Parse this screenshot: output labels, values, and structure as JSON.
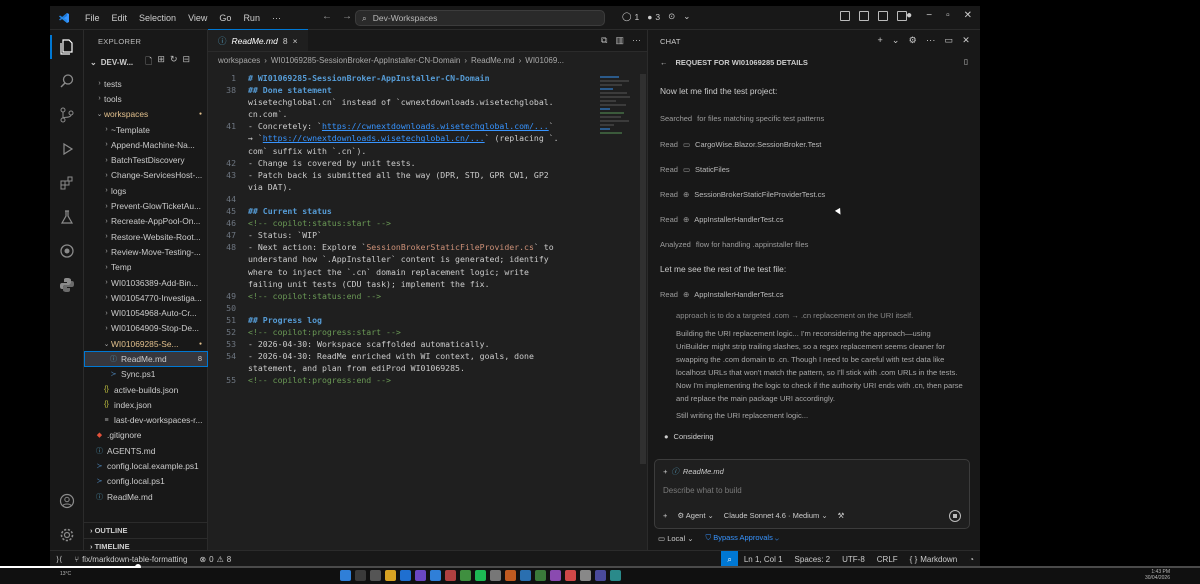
{
  "titlebar": {
    "menu": [
      "File",
      "Edit",
      "Selection",
      "View",
      "Go",
      "Run",
      "···"
    ],
    "search_text": "Dev-Workspaces",
    "counter1": "1",
    "counter2": "3"
  },
  "sidebar": {
    "header": "EXPLORER",
    "root": "DEV-W...",
    "items": [
      {
        "label": "tests",
        "type": "folder",
        "depth": 1,
        "open": false
      },
      {
        "label": "tools",
        "type": "folder",
        "depth": 1,
        "open": false
      },
      {
        "label": "workspaces",
        "type": "folder",
        "depth": 1,
        "open": true,
        "dot": true
      },
      {
        "label": "~Template",
        "type": "folder",
        "depth": 2,
        "open": false
      },
      {
        "label": "Append-Machine-Na...",
        "type": "folder",
        "depth": 2,
        "open": false
      },
      {
        "label": "BatchTestDiscovery",
        "type": "folder",
        "depth": 2,
        "open": false
      },
      {
        "label": "Change-ServicesHost-...",
        "type": "folder",
        "depth": 2,
        "open": false
      },
      {
        "label": "logs",
        "type": "folder",
        "depth": 2,
        "open": false
      },
      {
        "label": "Prevent-GlowTicketAu...",
        "type": "folder",
        "depth": 2,
        "open": false
      },
      {
        "label": "Recreate-AppPool-On...",
        "type": "folder",
        "depth": 2,
        "open": false
      },
      {
        "label": "Restore-Website-Root...",
        "type": "folder",
        "depth": 2,
        "open": false
      },
      {
        "label": "Review-Move-Testing-...",
        "type": "folder",
        "depth": 2,
        "open": false
      },
      {
        "label": "Temp",
        "type": "folder",
        "depth": 2,
        "open": false
      },
      {
        "label": "WI01036389-Add-Bin...",
        "type": "folder",
        "depth": 2,
        "open": false
      },
      {
        "label": "WI01054770-Investiga...",
        "type": "folder",
        "depth": 2,
        "open": false
      },
      {
        "label": "WI01054968-Auto-Cr...",
        "type": "folder",
        "depth": 2,
        "open": false
      },
      {
        "label": "WI01064909-Stop-De...",
        "type": "folder",
        "depth": 2,
        "open": false
      },
      {
        "label": "WI01069285-Se...",
        "type": "folder",
        "depth": 2,
        "open": true,
        "dot": true
      },
      {
        "label": "ReadMe.md",
        "type": "md",
        "depth": 3,
        "badge": "8",
        "selected": true
      },
      {
        "label": "Sync.ps1",
        "type": "ps1",
        "depth": 3
      },
      {
        "label": "active-builds.json",
        "type": "json",
        "depth": 2
      },
      {
        "label": "index.json",
        "type": "json",
        "depth": 2
      },
      {
        "label": "last-dev-workspaces-r...",
        "type": "txt",
        "depth": 2
      },
      {
        "label": ".gitignore",
        "type": "git",
        "depth": 1
      },
      {
        "label": "AGENTS.md",
        "type": "md",
        "depth": 1
      },
      {
        "label": "config.local.example.ps1",
        "type": "ps1",
        "depth": 1
      },
      {
        "label": "config.local.ps1",
        "type": "ps1",
        "depth": 1
      },
      {
        "label": "ReadMe.md",
        "type": "md",
        "depth": 1
      }
    ],
    "outline": "OUTLINE",
    "timeline": "TIMELINE"
  },
  "editor": {
    "tab_label": "ReadMe.md",
    "tab_badge": "8",
    "breadcrumb": [
      "workspaces",
      "WI01069285-SessionBroker-AppInstaller-CN-Domain",
      "ReadMe.md",
      "WI01069..."
    ],
    "lines": [
      {
        "n": "1",
        "parts": [
          [
            "hd",
            "# WI01069285-SessionBroker-AppInstaller-CN-Domain"
          ]
        ]
      },
      {
        "n": "38",
        "parts": [
          [
            "hd",
            "## Done statement"
          ]
        ]
      },
      {
        "n": "",
        "parts": [
          [
            "txt",
            "wisetechglobal.cn` instead of `cwnextdownloads.wisetechglobal."
          ]
        ]
      },
      {
        "n": "",
        "parts": [
          [
            "txt",
            "cn.com`."
          ]
        ]
      },
      {
        "n": "41",
        "parts": [
          [
            "txt",
            "- Concretely: `"
          ],
          [
            "link",
            "https://cwnextdownloads.wisetechglobal.com/..."
          ],
          [
            "txt",
            "`"
          ]
        ]
      },
      {
        "n": "",
        "parts": [
          [
            "txt",
            "→ `"
          ],
          [
            "link",
            "https://cwnextdownloads.wisetechglobal.cn/..."
          ],
          [
            "txt",
            "` (replacing `."
          ]
        ]
      },
      {
        "n": "",
        "parts": [
          [
            "txt",
            "com` suffix with `.cn`)."
          ]
        ]
      },
      {
        "n": "42",
        "parts": [
          [
            "txt",
            "- Change is covered by unit tests."
          ]
        ]
      },
      {
        "n": "43",
        "parts": [
          [
            "txt",
            "- Patch back is submitted all the way (DPR, STD, GPR CW1, GP2"
          ]
        ]
      },
      {
        "n": "",
        "parts": [
          [
            "txt",
            "via DAT)."
          ]
        ]
      },
      {
        "n": "44",
        "parts": [
          [
            "txt",
            ""
          ]
        ]
      },
      {
        "n": "45",
        "parts": [
          [
            "hd",
            "## Current status"
          ]
        ]
      },
      {
        "n": "46",
        "parts": [
          [
            "cm",
            "<!-- copilot:status:start -->"
          ]
        ]
      },
      {
        "n": "47",
        "parts": [
          [
            "txt",
            "- Status: `WIP`"
          ]
        ]
      },
      {
        "n": "48",
        "parts": [
          [
            "txt",
            "- Next action: Explore `"
          ],
          [
            "code-inline",
            "SessionBrokerStaticFileProvider.cs"
          ],
          [
            "txt",
            "` to"
          ]
        ]
      },
      {
        "n": "",
        "parts": [
          [
            "txt",
            "understand how `.AppInstaller` content is generated; identify"
          ]
        ]
      },
      {
        "n": "",
        "parts": [
          [
            "txt",
            "where to inject the `.cn` domain replacement logic; write"
          ]
        ]
      },
      {
        "n": "",
        "parts": [
          [
            "txt",
            "failing unit tests (CDU task); implement the fix."
          ]
        ]
      },
      {
        "n": "49",
        "parts": [
          [
            "cm",
            "<!-- copilot:status:end -->"
          ]
        ]
      },
      {
        "n": "50",
        "parts": [
          [
            "txt",
            ""
          ]
        ]
      },
      {
        "n": "51",
        "parts": [
          [
            "hd",
            "## Progress log"
          ]
        ]
      },
      {
        "n": "52",
        "parts": [
          [
            "cm",
            "<!-- copilot:progress:start -->"
          ]
        ]
      },
      {
        "n": "53",
        "parts": [
          [
            "txt",
            "- 2026-04-30: Workspace scaffolded automatically."
          ]
        ]
      },
      {
        "n": "54",
        "parts": [
          [
            "txt",
            "- 2026-04-30: ReadMe enriched with WI context, goals, done"
          ]
        ]
      },
      {
        "n": "",
        "parts": [
          [
            "txt",
            "statement, and plan from ediProd WI01069285."
          ]
        ]
      },
      {
        "n": "55",
        "parts": [
          [
            "cm",
            "<!-- copilot:progress:end -->"
          ]
        ]
      }
    ]
  },
  "chat": {
    "header": "CHAT",
    "title": "REQUEST FOR WI01069285 DETAILS",
    "intro": "Now let me find the test project:",
    "searched": {
      "verb": "Searched",
      "text": "for files matching specific test patterns"
    },
    "reads": [
      {
        "verb": "Read",
        "file": "CargoWise.Blazor.SessionBroker.Test"
      },
      {
        "verb": "Read",
        "file": "StaticFiles"
      },
      {
        "verb": "Read",
        "file": "SessionBrokerStaticFileProviderTest.cs"
      },
      {
        "verb": "Read",
        "file": "AppInstallerHandlerTest.cs"
      }
    ],
    "analyzed": {
      "verb": "Analyzed",
      "text": "flow for handling .appinstaller files"
    },
    "rest": "Let me see the rest of the test file:",
    "read_last": {
      "verb": "Read",
      "file": "AppInstallerHandlerTest.cs"
    },
    "thinking_top": "approach is to do a targeted .com → .cn replacement on the URI itself.",
    "thinking_main": "Building the URI replacement logic... I'm reconsidering the approach—using UriBuilder might strip trailing slashes, so a regex replacement seems cleaner for swapping the .com domain to .cn. Though I need to be careful with test data like localhost URLs that won't match the pattern, so I'll stick with .com URLs in the tests. Now I'm implementing the logic to check if the authority URI ends with .cn, then parse and replace the main package URI accordingly.",
    "thinking_tail": "Still writing the URI replacement logic...",
    "considering": "Considering",
    "attach": "ReadMe.md",
    "placeholder": "Describe what to build",
    "agent": "Agent",
    "model": "Claude Sonnet 4.6 · Medium",
    "local": "Local",
    "bypass": "Bypass Approvals"
  },
  "statusbar": {
    "branch": "fix/markdown-table-formatting",
    "errors": "0",
    "warnings": "8",
    "position": "Ln 1, Col 1",
    "spaces": "Spaces: 2",
    "encoding": "UTF-8",
    "eol": "CRLF",
    "language": "Markdown"
  },
  "taskbar": {
    "weather": "13°C",
    "time": "1:43 PM",
    "date": "30/04/2026"
  },
  "video": {
    "progress": 0.115
  },
  "colors": {
    "accent": "#0078d4",
    "folder": "#e2c08d",
    "heading": "#569cd6",
    "comment": "#6a9955",
    "link": "#3794ff"
  }
}
